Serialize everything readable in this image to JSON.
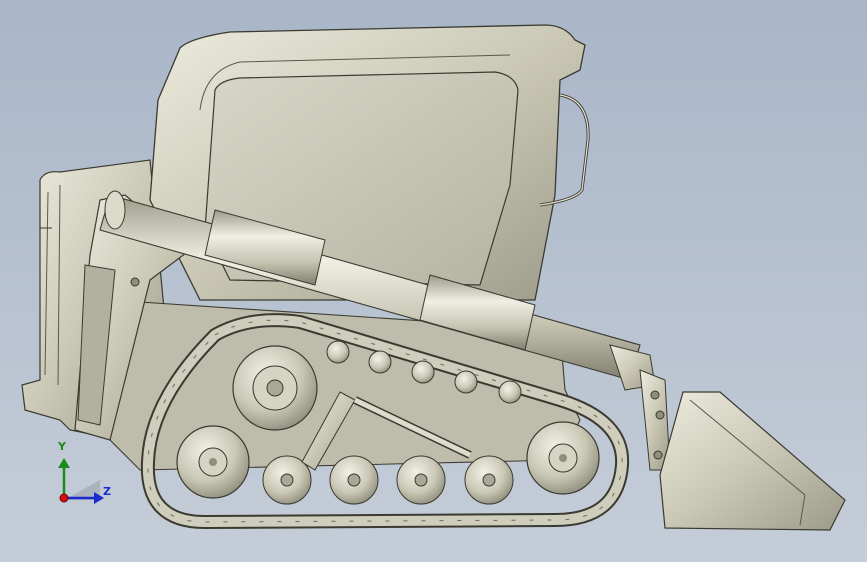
{
  "viewport": {
    "background_top": "#a9b6c8",
    "background_bottom": "#c5cdd8"
  },
  "model": {
    "shade_light": "#e4e2d2",
    "shade_mid": "#c7c5b2",
    "shade_dark": "#8f8d7c",
    "edge_color": "#3a3a30"
  },
  "triad": {
    "y_label": "Y",
    "z_label": "Z",
    "y_color": "#1a8a1a",
    "z_color": "#1a2ad0",
    "x_color": "#d01010"
  }
}
